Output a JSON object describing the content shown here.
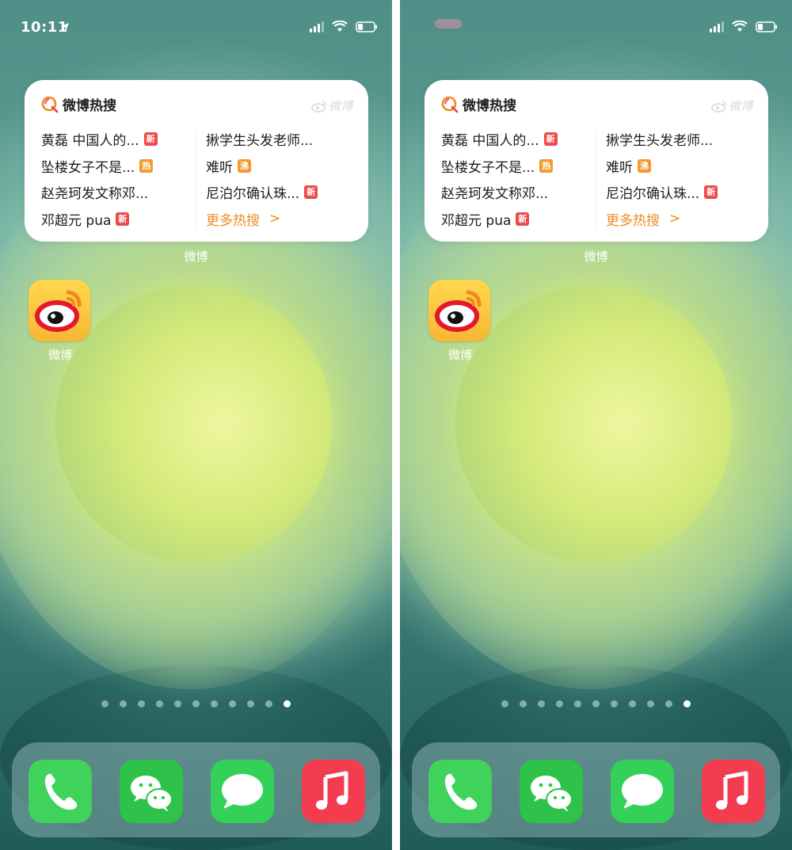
{
  "screens": [
    {
      "status": {
        "time": "10:11"
      },
      "widget": {
        "title": "微博热搜",
        "watermark": "微博",
        "left_items": [
          {
            "text": "黄磊 中国人的...",
            "badge": "新",
            "badge_color": "#ee4a4a"
          },
          {
            "text": "坠楼女子不是...",
            "badge": "热",
            "badge_color": "#f29a2c"
          },
          {
            "text": "赵尧珂发文称邓...",
            "badge": "",
            "badge_color": ""
          },
          {
            "text": "邓超元 pua",
            "badge": "新",
            "badge_color": "#ee4a4a"
          }
        ],
        "right_items": [
          {
            "text": "揪学生头发老师...",
            "badge": "",
            "badge_color": ""
          },
          {
            "text": "难听",
            "badge": "沸",
            "badge_color": "#f29a2c"
          },
          {
            "text": "尼泊尔确认珠...",
            "badge": "新",
            "badge_color": "#ee4a4a"
          }
        ],
        "more": "更多热搜",
        "more_chevron": ">"
      },
      "widget_caption": "微博",
      "app": {
        "label": "微博",
        "icon": "weibo-icon"
      },
      "page_dots": {
        "count": 11,
        "active_index": 10
      },
      "dock": [
        "phone-icon",
        "wechat-icon",
        "messages-icon",
        "music-icon"
      ]
    },
    {
      "status": {
        "time": ""
      },
      "widget": {
        "title": "微博热搜",
        "watermark": "微博",
        "left_items": [
          {
            "text": "黄磊 中国人的...",
            "badge": "新",
            "badge_color": "#ee4a4a"
          },
          {
            "text": "坠楼女子不是...",
            "badge": "热",
            "badge_color": "#f29a2c"
          },
          {
            "text": "赵尧珂发文称邓...",
            "badge": "",
            "badge_color": ""
          },
          {
            "text": "邓超元 pua",
            "badge": "新",
            "badge_color": "#ee4a4a"
          }
        ],
        "right_items": [
          {
            "text": "揪学生头发老师...",
            "badge": "",
            "badge_color": ""
          },
          {
            "text": "难听",
            "badge": "沸",
            "badge_color": "#f29a2c"
          },
          {
            "text": "尼泊尔确认珠...",
            "badge": "新",
            "badge_color": "#ee4a4a"
          }
        ],
        "more": "更多热搜",
        "more_chevron": ">"
      },
      "widget_caption": "微博",
      "app": {
        "label": "微博",
        "icon": "weibo-icon"
      },
      "page_dots": {
        "count": 11,
        "active_index": 10
      },
      "dock": [
        "phone-icon",
        "wechat-icon",
        "messages-icon",
        "music-icon"
      ]
    }
  ],
  "colors": {
    "accent_orange": "#f08a1e",
    "badge_new": "#ee4a4a",
    "badge_hot": "#f29a2c",
    "phone_green": "#3fd35b",
    "wechat_green": "#2fc24a",
    "messages_green": "#34d158",
    "music_red": "#f43c51"
  }
}
